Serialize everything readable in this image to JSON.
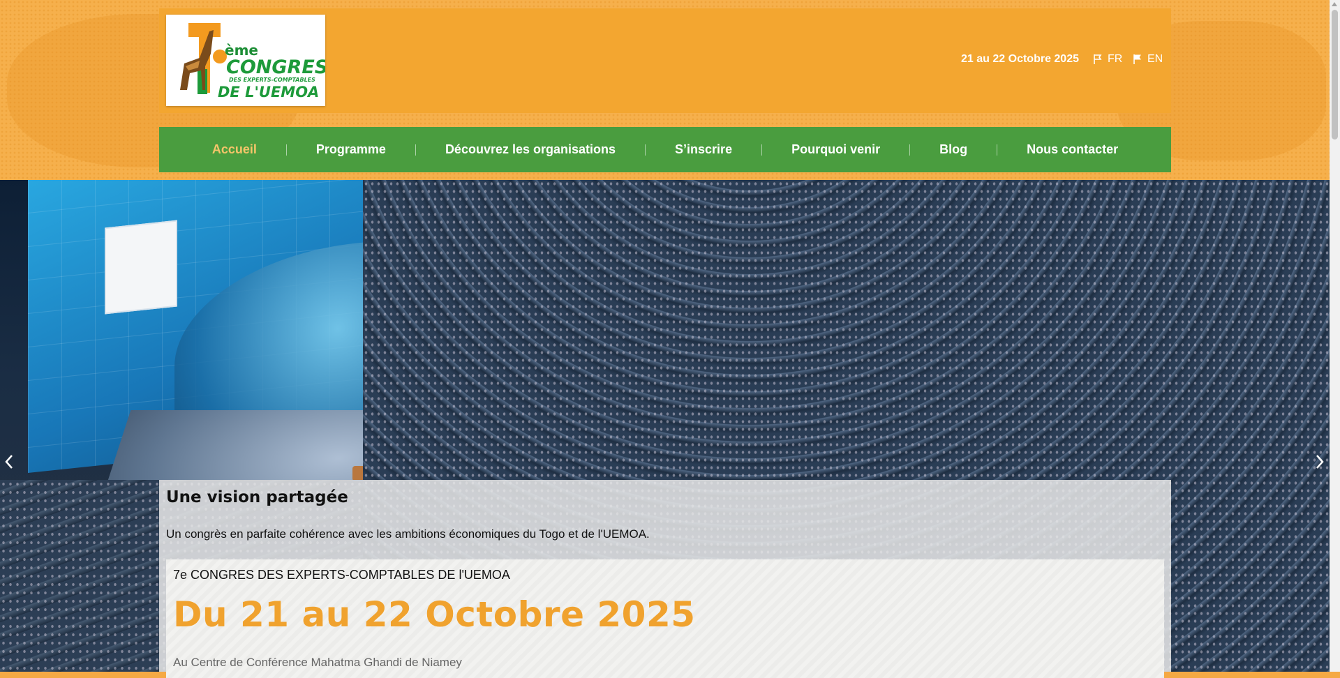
{
  "header": {
    "logo": {
      "number": "7",
      "suffix": "ème",
      "line1": "CONGRES",
      "line2": "DES EXPERTS-COMPTABLES",
      "line3": "DE L'UEMOA"
    },
    "event_dates": "21 au 22 Octobre 2025",
    "languages": [
      {
        "code": "FR"
      },
      {
        "code": "EN"
      }
    ]
  },
  "nav": {
    "items": [
      {
        "label": "Accueil",
        "active": true
      },
      {
        "label": "Programme"
      },
      {
        "label": "Découvrez les organisations"
      },
      {
        "label": "S’inscrire"
      },
      {
        "label": "Pourquoi venir"
      },
      {
        "label": "Blog"
      },
      {
        "label": "Nous contacter"
      }
    ]
  },
  "hero": {
    "prev_icon": "chevron-left-icon",
    "next_icon": "chevron-right-icon"
  },
  "panel": {
    "title": "Une vision partagée",
    "subtitle": "Un congrès en parfaite cohérence avec les ambitions économiques du Togo et de l'UEMOA.",
    "card": {
      "kicker": "7e CONGRES DES EXPERTS-COMPTABLES DE l'UEMOA",
      "date": "Du 21 au 22 Octobre 2025",
      "venue": "Au Centre de Conférence Mahatma Ghandi de Niamey"
    }
  },
  "colors": {
    "header_orange": "#f6b04c",
    "nav_green": "#4a9d3f",
    "active_nav": "#f6c56a",
    "date_orange": "#f0a22e"
  }
}
